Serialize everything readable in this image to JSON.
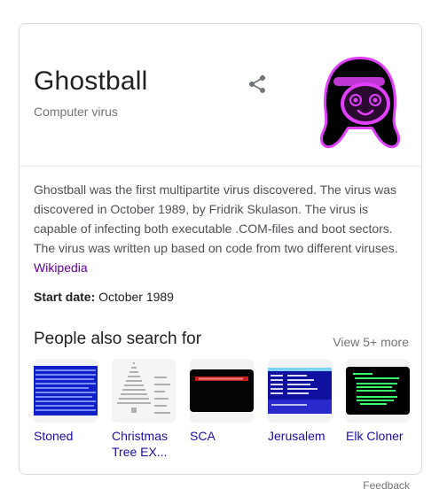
{
  "entity": {
    "title": "Ghostball",
    "subtitle": "Computer virus",
    "description": "Ghostball was the first multipartite virus discovered. The virus was discovered in October 1989, by Fridrik Skulason. The virus is capable of infecting both executable .COM-files and boot sectors. The virus was written up based on code from two different viruses.",
    "source_link": "Wikipedia"
  },
  "facts": [
    {
      "label": "Start date:",
      "value": "October 1989"
    }
  ],
  "people_also_search": {
    "heading": "People also search for",
    "view_more": "View 5+ more",
    "items": [
      {
        "label": "Stoned"
      },
      {
        "label": "Christmas Tree EX..."
      },
      {
        "label": "SCA"
      },
      {
        "label": "Jerusalem"
      },
      {
        "label": "Elk Cloner"
      }
    ]
  },
  "footer": {
    "feedback": "Feedback"
  },
  "icons": {
    "share": "share-icon"
  },
  "colors": {
    "link": "#1a0dab",
    "visited_link": "#660099",
    "muted": "#70757a",
    "mascot_glow": "#e040fb"
  }
}
